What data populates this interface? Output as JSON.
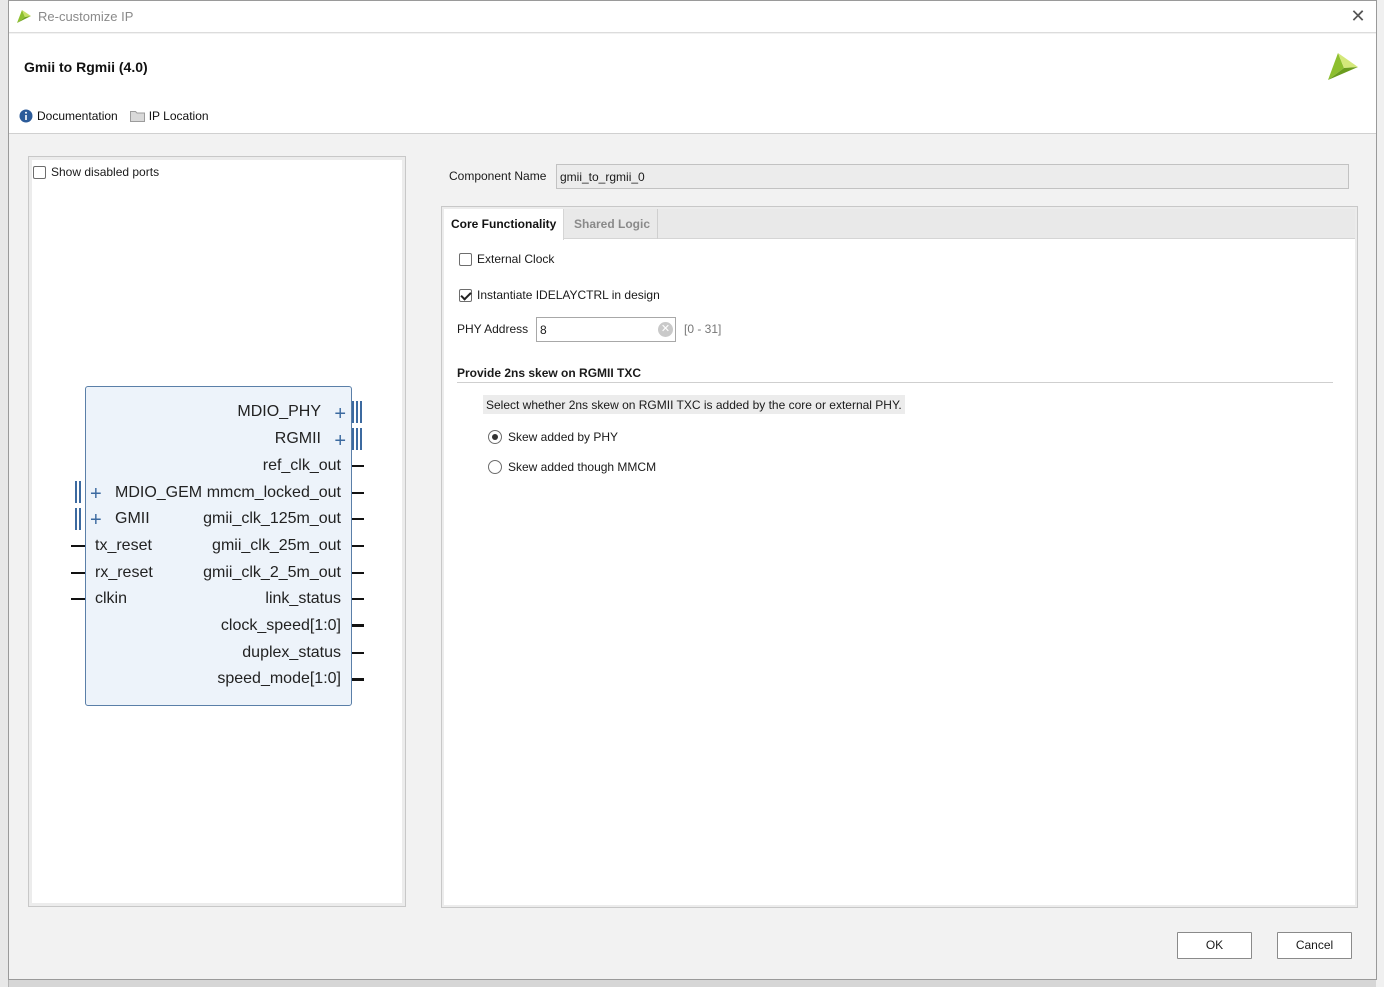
{
  "window": {
    "title": "Re-customize IP"
  },
  "header": {
    "ip_title": "Gmii to Rgmii (4.0)",
    "links": {
      "documentation": "Documentation",
      "ip_location": "IP Location"
    }
  },
  "symbol_panel": {
    "show_disabled_ports": {
      "label": "Show disabled ports",
      "checked": false
    },
    "right_ports": [
      "MDIO_PHY",
      "RGMII",
      "ref_clk_out",
      "mmcm_locked_out",
      "gmii_clk_125m_out",
      "gmii_clk_25m_out",
      "gmii_clk_2_5m_out",
      "link_status",
      "clock_speed[1:0]",
      "duplex_status",
      "speed_mode[1:0]"
    ],
    "left_ports": [
      "MDIO_GEM",
      "GMII",
      "tx_reset",
      "rx_reset",
      "clkin"
    ]
  },
  "component": {
    "label": "Component Name",
    "value": "gmii_to_rgmii_0"
  },
  "tabs": [
    {
      "label": "Core Functionality",
      "active": true
    },
    {
      "label": "Shared Logic",
      "active": false
    }
  ],
  "core": {
    "external_clock": {
      "label": "External Clock",
      "checked": false
    },
    "idelayctrl": {
      "label": "Instantiate IDELAYCTRL in design",
      "checked": true
    },
    "phy_address": {
      "label": "PHY Address",
      "value": "8",
      "range": "[0 - 31]"
    },
    "skew_section": {
      "title": "Provide 2ns skew on RGMII TXC",
      "hint": "Select whether 2ns skew on RGMII TXC is added by the core or external PHY.",
      "options": [
        {
          "label": "Skew added by PHY",
          "selected": true
        },
        {
          "label": "Skew added though MMCM",
          "selected": false
        }
      ]
    }
  },
  "buttons": {
    "ok": "OK",
    "cancel": "Cancel"
  },
  "colors": {
    "block_fill": "#edf3fa",
    "block_border": "#5a7fa8",
    "bus_pin": "#3c6aa0",
    "logo_green": "#8dbf2e"
  }
}
